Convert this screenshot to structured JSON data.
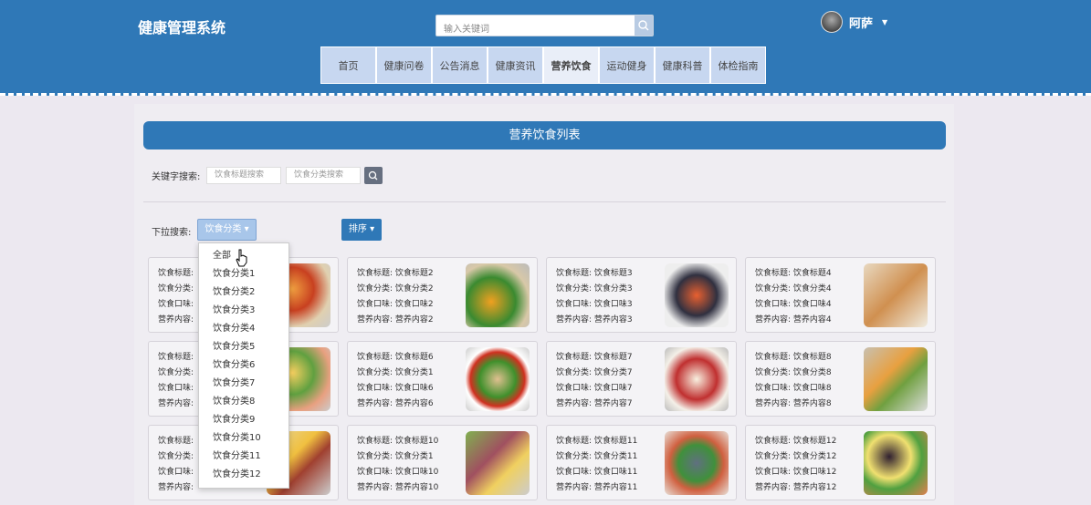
{
  "app": {
    "title": "健康管理系统"
  },
  "search": {
    "placeholder": "输入关键词"
  },
  "user": {
    "name": "阿萨"
  },
  "nav": [
    "首页",
    "健康问卷",
    "公告消息",
    "健康资讯",
    "营养饮食",
    "运动健身",
    "健康科普",
    "体检指南"
  ],
  "page": {
    "title": "营养饮食列表"
  },
  "filter": {
    "keyword_label": "关键字搜索:",
    "title_placeholder": "饮食标题搜索",
    "category_placeholder": "饮食分类搜索",
    "dropdown_label": "下拉搜索:",
    "dropdown_value": "饮食分类 ▾",
    "sort_label": "排序 ▾"
  },
  "dropdown_menu": [
    "全部",
    "饮食分类1",
    "饮食分类2",
    "饮食分类3",
    "饮食分类4",
    "饮食分类5",
    "饮食分类6",
    "饮食分类7",
    "饮食分类8",
    "饮食分类9",
    "饮食分类10",
    "饮食分类11",
    "饮食分类12"
  ],
  "cards": [
    {
      "title": "饮食标题:",
      "cat": "饮食分类:",
      "taste": "饮食口味:",
      "content": "营养内容:"
    },
    {
      "title": "饮食标题: 饮食标题2",
      "cat": "饮食分类: 饮食分类2",
      "taste": "饮食口味: 饮食口味2",
      "content": "营养内容: 营养内容2"
    },
    {
      "title": "饮食标题: 饮食标题3",
      "cat": "饮食分类: 饮食分类3",
      "taste": "饮食口味: 饮食口味3",
      "content": "营养内容: 营养内容3"
    },
    {
      "title": "饮食标题: 饮食标题4",
      "cat": "饮食分类: 饮食分类4",
      "taste": "饮食口味: 饮食口味4",
      "content": "营养内容: 营养内容4"
    },
    {
      "title": "饮食标题:",
      "cat": "饮食分类:",
      "taste": "饮食口味:",
      "content": "营养内容:"
    },
    {
      "title": "饮食标题: 饮食标题6",
      "cat": "饮食分类: 饮食分类1",
      "taste": "饮食口味: 饮食口味6",
      "content": "营养内容: 营养内容6"
    },
    {
      "title": "饮食标题: 饮食标题7",
      "cat": "饮食分类: 饮食分类7",
      "taste": "饮食口味: 饮食口味7",
      "content": "营养内容: 营养内容7"
    },
    {
      "title": "饮食标题: 饮食标题8",
      "cat": "饮食分类: 饮食分类8",
      "taste": "饮食口味: 饮食口味8",
      "content": "营养内容: 营养内容8"
    },
    {
      "title": "饮食标题:",
      "cat": "饮食分类:",
      "taste": "饮食口味:",
      "content": "营养内容:"
    },
    {
      "title": "饮食标题: 饮食标题10",
      "cat": "饮食分类: 饮食分类1",
      "taste": "饮食口味: 饮食口味10",
      "content": "营养内容: 营养内容10"
    },
    {
      "title": "饮食标题: 饮食标题11",
      "cat": "饮食分类: 饮食分类11",
      "taste": "饮食口味: 饮食口味11",
      "content": "营养内容: 营养内容11"
    },
    {
      "title": "饮食标题: 饮食标题12",
      "cat": "饮食分类: 饮食分类12",
      "taste": "饮食口味: 饮食口味12",
      "content": "营养内容: 营养内容12"
    }
  ]
}
